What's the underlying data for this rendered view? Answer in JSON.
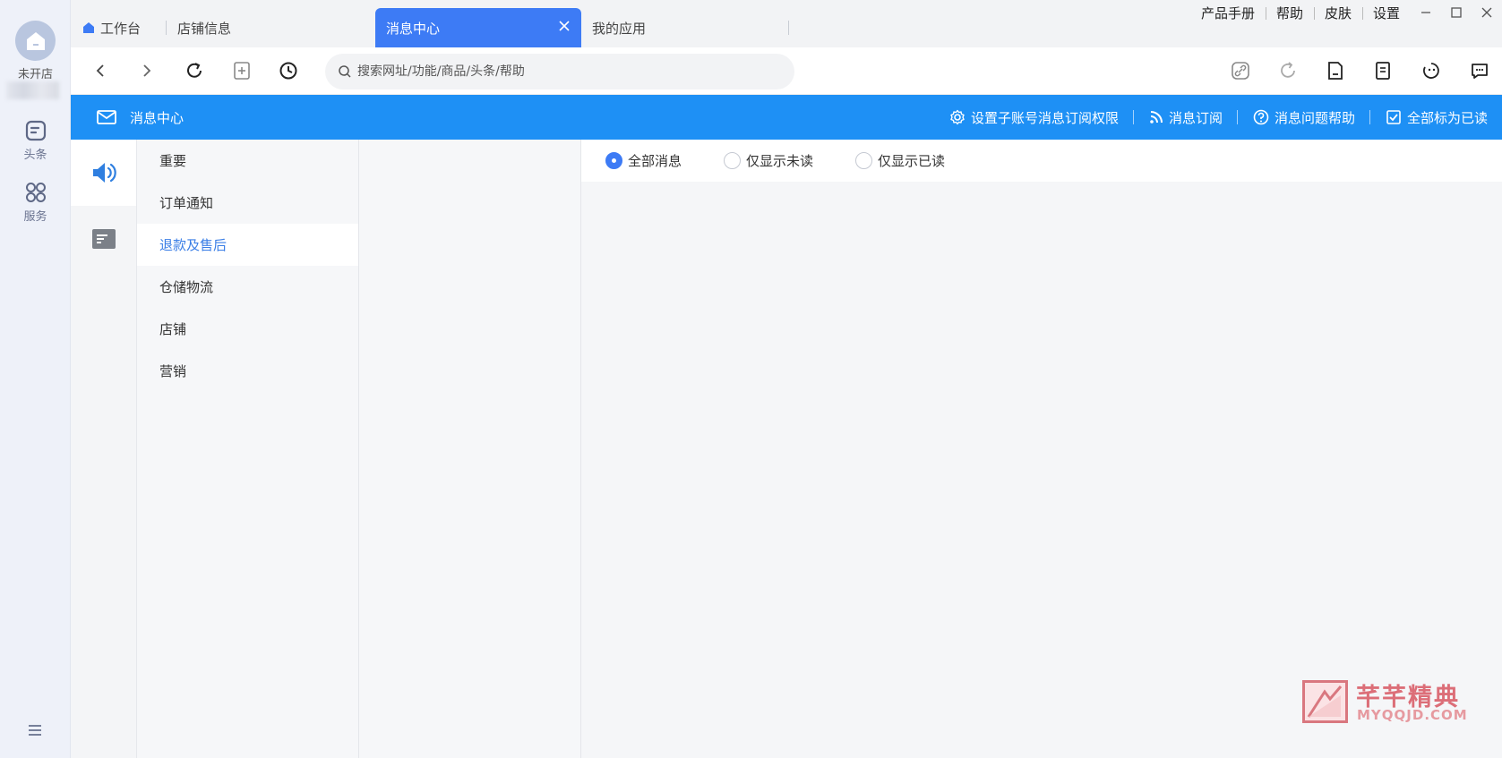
{
  "rail": {
    "shop_name": "未开店",
    "items": [
      {
        "label": "头条",
        "icon": "doc-icon"
      },
      {
        "label": "服务",
        "icon": "grid-icon"
      }
    ]
  },
  "tabs": [
    {
      "label": "工作台",
      "icon": "home-icon",
      "active": false
    },
    {
      "label": "店铺信息",
      "active": false
    },
    {
      "label": "消息中心",
      "active": true
    },
    {
      "label": "我的应用",
      "active": false
    }
  ],
  "top_links": [
    "产品手册",
    "帮助",
    "皮肤",
    "设置"
  ],
  "search": {
    "placeholder": "搜索网址/功能/商品/头条/帮助"
  },
  "header": {
    "title": "消息中心",
    "actions": [
      {
        "label": "设置子账号消息订阅权限",
        "icon": "gear-icon"
      },
      {
        "label": "消息订阅",
        "icon": "rss-icon"
      },
      {
        "label": "消息问题帮助",
        "icon": "help-icon"
      },
      {
        "label": "全部标为已读",
        "icon": "checkbox-icon"
      }
    ]
  },
  "categories": [
    {
      "label": "重要",
      "selected": false
    },
    {
      "label": "订单通知",
      "selected": false
    },
    {
      "label": "退款及售后",
      "selected": true
    },
    {
      "label": "仓储物流",
      "selected": false
    },
    {
      "label": "店铺",
      "selected": false
    },
    {
      "label": "营销",
      "selected": false
    }
  ],
  "filters": [
    {
      "label": "全部消息",
      "checked": true
    },
    {
      "label": "仅显示未读",
      "checked": false
    },
    {
      "label": "仅显示已读",
      "checked": false
    }
  ],
  "watermark": {
    "cn": "芊芊精典",
    "en": "MYQQJD.COM"
  },
  "colors": {
    "accent": "#3d7bf5",
    "header_blue": "#1e90f5",
    "selected_text": "#3a7ee6"
  }
}
